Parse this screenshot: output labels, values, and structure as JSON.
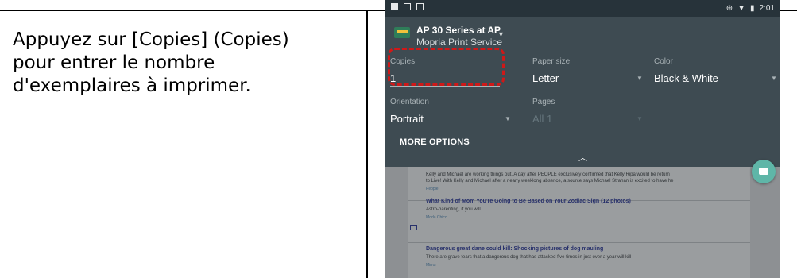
{
  "instruction": {
    "lines": [
      "Appuyez sur [Copies] (Copies)",
      "pour entrer le nombre",
      "d'exemplaires à imprimer."
    ]
  },
  "status_bar": {
    "time": "2:01"
  },
  "print_dialog": {
    "printer_name": "AP 30 Series at AP",
    "printer_service": "Mopria Print Service",
    "copies": {
      "label": "Copies",
      "value": "1"
    },
    "paper_size": {
      "label": "Paper size",
      "value": "Letter"
    },
    "color": {
      "label": "Color",
      "value": "Black & White"
    },
    "orientation": {
      "label": "Orientation",
      "value": "Portrait"
    },
    "pages": {
      "label": "Pages",
      "value": "All 1"
    },
    "more_options": "MORE OPTIONS"
  },
  "feed": {
    "items": [
      {
        "title": "",
        "text": "Kelly and Michael are working things out. A day after PEOPLE exclusively confirmed that Kelly Ripa would be return",
        "text2": "to Live! With Kelly and Michael after a nearly weeklong absence, a source says Michael Strahan is excited to have he",
        "source": "People"
      },
      {
        "title": "What Kind of Mom You're Going to Be Based on Your Zodiac Sign (12 photos)",
        "text": "Astro-parenting, if you will.",
        "source": "Moda Chicc"
      },
      {
        "title": "Dangerous great dane could kill: Shocking pictures of dog mauling",
        "text": "There are grave fears that a dangerous dog that has attacked five times in just over a year will kill",
        "source": "Mirror"
      }
    ]
  },
  "colors": {
    "highlight": "#d01818",
    "sheet_background": "#3e4b52",
    "fab": "#5fb6a8"
  }
}
